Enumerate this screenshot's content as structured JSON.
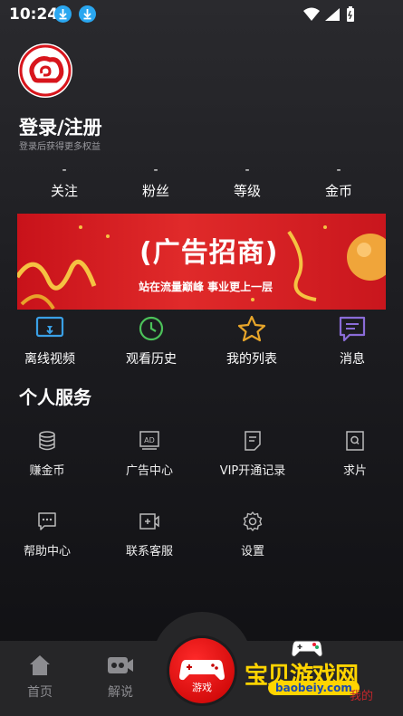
{
  "status_bar": {
    "time": "10:24"
  },
  "profile": {
    "title": "登录/注册",
    "subtitle": "登录后获得更多权益"
  },
  "stats": [
    {
      "value": "-",
      "label": "关注"
    },
    {
      "value": "-",
      "label": "粉丝"
    },
    {
      "value": "-",
      "label": "等级"
    },
    {
      "value": "-",
      "label": "金币"
    }
  ],
  "banner": {
    "title": "(广告招商)",
    "subtitle": "站在流量巅峰  事业更上一层"
  },
  "quick_actions": [
    {
      "label": "离线视频",
      "icon": "offline-video-icon",
      "color": "#3aa0e6"
    },
    {
      "label": "观看历史",
      "icon": "history-clock-icon",
      "color": "#4cc25a"
    },
    {
      "label": "我的列表",
      "icon": "star-icon",
      "color": "#e7a52a"
    },
    {
      "label": "消息",
      "icon": "message-icon",
      "color": "#8a6cd8"
    }
  ],
  "services": {
    "title": "个人服务",
    "items": [
      {
        "label": "赚金币",
        "icon": "coins-icon"
      },
      {
        "label": "广告中心",
        "icon": "ad-icon"
      },
      {
        "label": "VIP开通记录",
        "icon": "document-icon"
      },
      {
        "label": "求片",
        "icon": "search-film-icon"
      },
      {
        "label": "帮助中心",
        "icon": "help-chat-icon"
      },
      {
        "label": "联系客服",
        "icon": "service-video-icon"
      },
      {
        "label": "设置",
        "icon": "gear-icon"
      }
    ]
  },
  "tabbar": {
    "home": "首页",
    "commentary": "解说",
    "game": "游戏",
    "mine_partial": "我的"
  },
  "watermark": {
    "title": "宝贝游戏网",
    "url": "baobeiy.com"
  },
  "colors": {
    "accent_red": "#d8151c",
    "watermark_yellow": "#ffd400"
  }
}
